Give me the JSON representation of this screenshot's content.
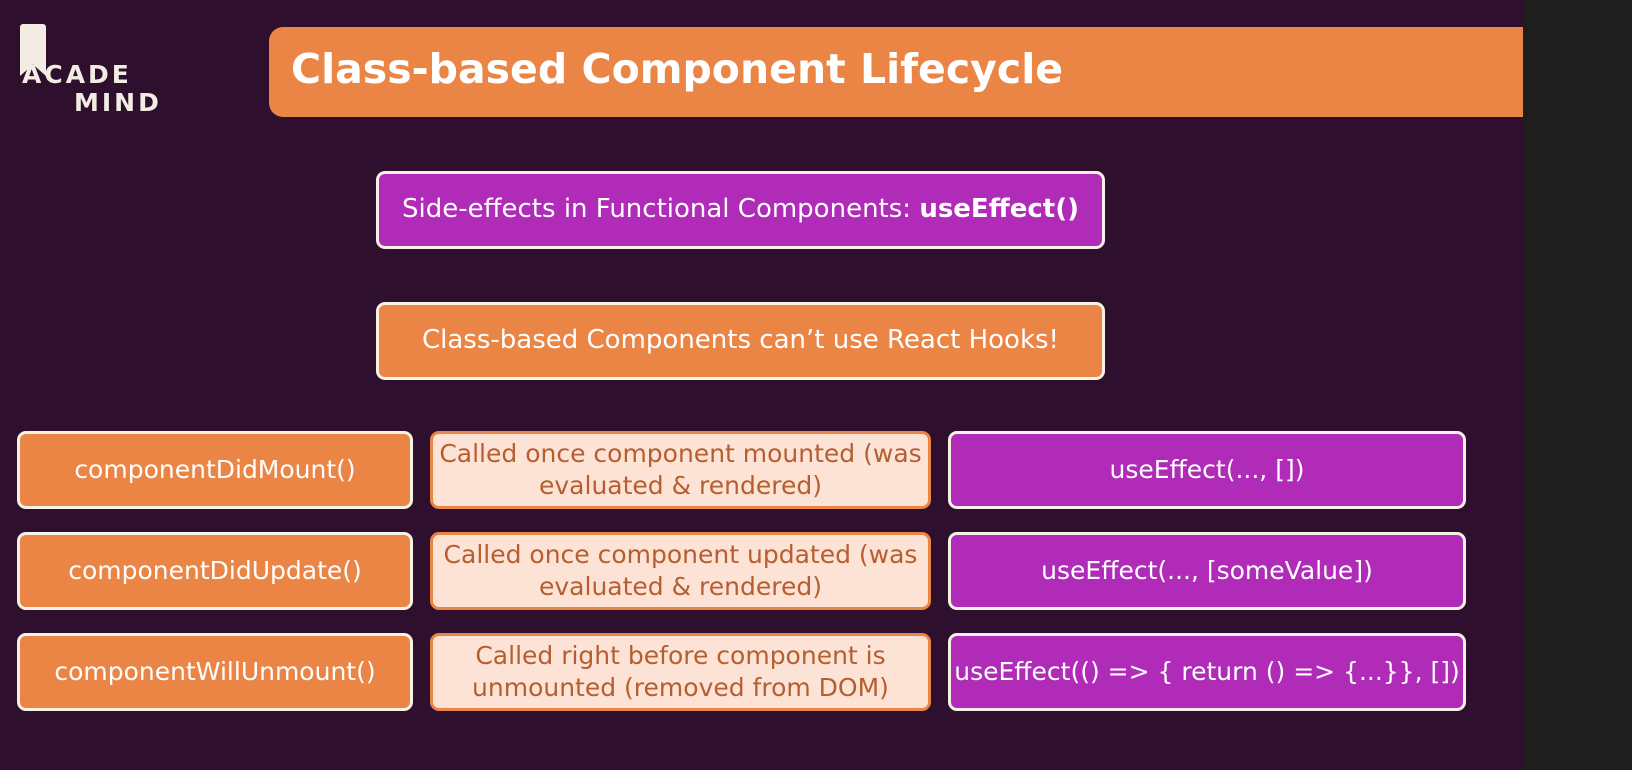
{
  "logo": {
    "line1": "ACADE",
    "line2": "MIND"
  },
  "title": "Class-based Component Lifecycle",
  "callouts": {
    "hooks_intro": {
      "text": "Side-effects in Functional Components: ",
      "bold": "useEffect()"
    },
    "class_note": "Class-based Components can’t use React Hooks!"
  },
  "rows": [
    {
      "method": "componentDidMount()",
      "description": "Called once component mounted (was evaluated & rendered)",
      "hook": "useEffect(..., [])"
    },
    {
      "method": "componentDidUpdate()",
      "description": "Called once component updated (was evaluated & rendered)",
      "hook": "useEffect(..., [someValue])"
    },
    {
      "method": "componentWillUnmount()",
      "description": "Called right before component is unmounted (removed from DOM)",
      "hook": "useEffect(() => { return () => {...}}, [])"
    }
  ],
  "colors": {
    "background": "#2e0f2e",
    "accent_orange": "#eb8545",
    "accent_magenta": "#b02bb8",
    "light_box": "#fce3d5"
  }
}
